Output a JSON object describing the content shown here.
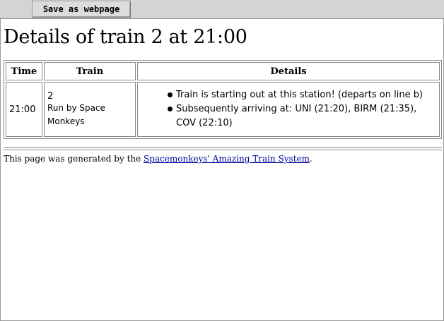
{
  "toolbar": {
    "save_label": "Save as webpage"
  },
  "page": {
    "title": "Details of train 2 at 21:00"
  },
  "table": {
    "headers": [
      "Time",
      "Train",
      "Details"
    ],
    "rows": [
      {
        "time": "21:00",
        "train_number": "2",
        "train_operator": "Run by Space Monkeys",
        "events": [
          "Train is starting out at this station! (departs on line b)",
          "Subsequently arriving at: UNI (21:20), BIRM (21:35), COV (22:10)"
        ]
      }
    ]
  },
  "footer": {
    "prefix": "This page was generated by the ",
    "link_text": "Spacemonkeys' Amazing Train System",
    "suffix": "."
  },
  "colors": {
    "link": "#000099",
    "toolbar_bg": "#d4d4d4"
  }
}
